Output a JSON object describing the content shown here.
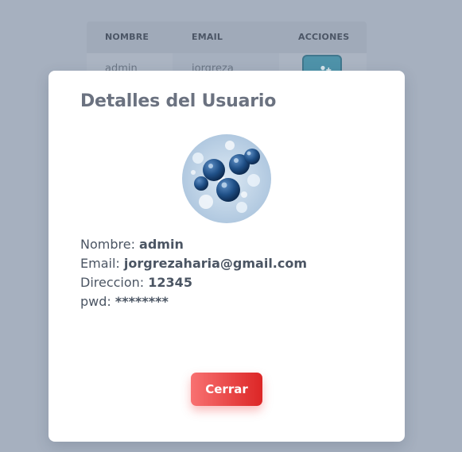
{
  "table": {
    "headers": {
      "nombre": "NOMBRE",
      "email": "EMAIL",
      "acciones": "ACCIONES"
    },
    "row": {
      "nombre": "admin",
      "email": "jorgreza"
    }
  },
  "modal": {
    "title": "Detalles del Usuario",
    "fields": [
      {
        "label": "Nombre: ",
        "value": "admin"
      },
      {
        "label": "Email: ",
        "value": "jorgrezaharia@gmail.com"
      },
      {
        "label": "Direccion: ",
        "value": "12345"
      },
      {
        "label": "pwd: ",
        "value": "********"
      }
    ],
    "close_label": "Cerrar"
  },
  "colors": {
    "close_button_start": "#f87171",
    "close_button_end": "#dc2626",
    "title": "#6b7280",
    "action_button": "#3f8fa8"
  },
  "icons": {
    "action": "user-plus-icon"
  }
}
